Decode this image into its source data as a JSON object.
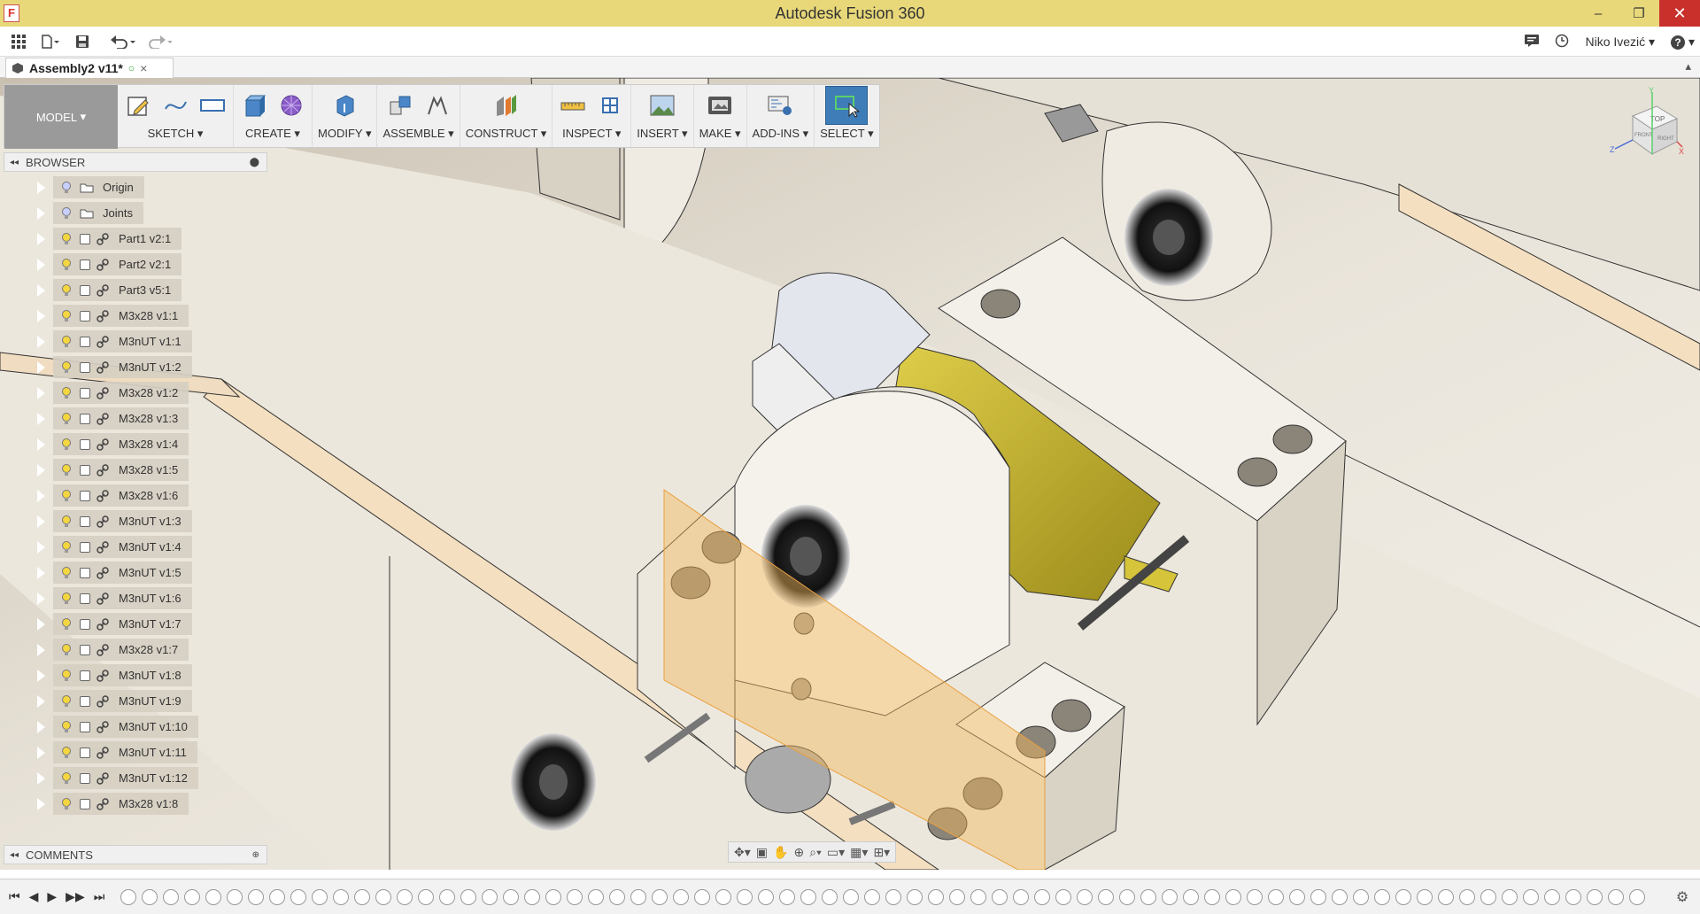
{
  "window": {
    "title": "Autodesk Fusion 360",
    "app_icon": "F",
    "controls": {
      "minimize": "–",
      "maximize": "❐",
      "close": "✕"
    }
  },
  "quick_access": {
    "user_name": "Niko Ivezić",
    "help": "?"
  },
  "document_tab": {
    "label": "Assembly2 v11*",
    "close": "×"
  },
  "toolbar": {
    "mode": "MODEL",
    "groups": [
      {
        "label": "SKETCH"
      },
      {
        "label": "CREATE"
      },
      {
        "label": "MODIFY"
      },
      {
        "label": "ASSEMBLE"
      },
      {
        "label": "CONSTRUCT"
      },
      {
        "label": "INSPECT"
      },
      {
        "label": "INSERT"
      },
      {
        "label": "MAKE"
      },
      {
        "label": "ADD-INS"
      },
      {
        "label": "SELECT"
      }
    ]
  },
  "browser": {
    "title": "BROWSER",
    "items": [
      {
        "name": "Origin"
      },
      {
        "name": "Joints"
      },
      {
        "name": "Part1 v2:1"
      },
      {
        "name": "Part2 v2:1"
      },
      {
        "name": "Part3 v5:1"
      },
      {
        "name": "M3x28 v1:1"
      },
      {
        "name": "M3nUT v1:1"
      },
      {
        "name": "M3nUT v1:2"
      },
      {
        "name": "M3x28 v1:2"
      },
      {
        "name": "M3x28 v1:3"
      },
      {
        "name": "M3x28 v1:4"
      },
      {
        "name": "M3x28 v1:5"
      },
      {
        "name": "M3x28 v1:6"
      },
      {
        "name": "M3nUT v1:3"
      },
      {
        "name": "M3nUT v1:4"
      },
      {
        "name": "M3nUT v1:5"
      },
      {
        "name": "M3nUT v1:6"
      },
      {
        "name": "M3nUT v1:7"
      },
      {
        "name": "M3x28 v1:7"
      },
      {
        "name": "M3nUT v1:8"
      },
      {
        "name": "M3nUT v1:9"
      },
      {
        "name": "M3nUT v1:10"
      },
      {
        "name": "M3nUT v1:11"
      },
      {
        "name": "M3nUT v1:12"
      },
      {
        "name": "M3x28 v1:8"
      }
    ]
  },
  "comments": {
    "title": "COMMENTS"
  },
  "viewcube": {
    "top": "TOP",
    "front": "FRONT",
    "right": "RIGHT",
    "axis_x": "X",
    "axis_y": "Y",
    "axis_z": "Z"
  },
  "colors": {
    "titlebar": "#e8d879",
    "model_body": "#ece8dc",
    "yellow_part": "#c8b430",
    "plane": "#f3b85a"
  }
}
